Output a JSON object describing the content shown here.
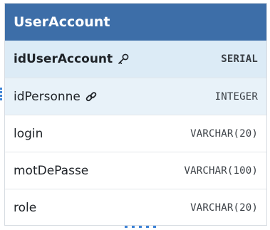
{
  "table": {
    "name": "UserAccount",
    "columns": [
      {
        "name": "idUserAccount",
        "type": "SERIAL",
        "key": "primary",
        "icon": "key-icon"
      },
      {
        "name": "idPersonne",
        "type": "INTEGER",
        "key": "foreign",
        "icon": "link-icon"
      },
      {
        "name": "login",
        "type": "VARCHAR(20)",
        "key": "",
        "icon": ""
      },
      {
        "name": "motDePasse",
        "type": "VARCHAR(100)",
        "key": "",
        "icon": ""
      },
      {
        "name": "role",
        "type": "VARCHAR(20)",
        "key": "",
        "icon": ""
      }
    ]
  },
  "colors": {
    "header_bg": "#3d6ea8",
    "pk_row_bg": "#dcebf6",
    "fk_row_bg": "#e8f2f9",
    "connector": "#3b82d6"
  }
}
